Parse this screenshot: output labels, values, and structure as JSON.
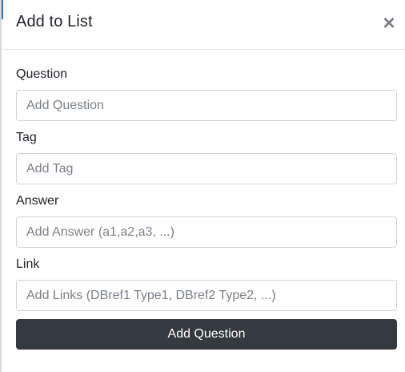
{
  "modal": {
    "title": "Add to List",
    "close_symbol": "×"
  },
  "form": {
    "fields": [
      {
        "label": "Question",
        "placeholder": "Add Question"
      },
      {
        "label": "Tag",
        "placeholder": "Add Tag"
      },
      {
        "label": "Answer",
        "placeholder": "Add Answer (a1,a2,a3, ...)"
      },
      {
        "label": "Link",
        "placeholder": "Add Links (DBref1 Type1, DBref2 Type2, ...)"
      }
    ],
    "submit_label": "Add Question"
  },
  "colors": {
    "button_bg": "#343a40",
    "button_text": "#ffffff",
    "close_icon": "#7d7f82",
    "input_border": "#ced4da"
  },
  "icons": {
    "close": "close-icon"
  }
}
